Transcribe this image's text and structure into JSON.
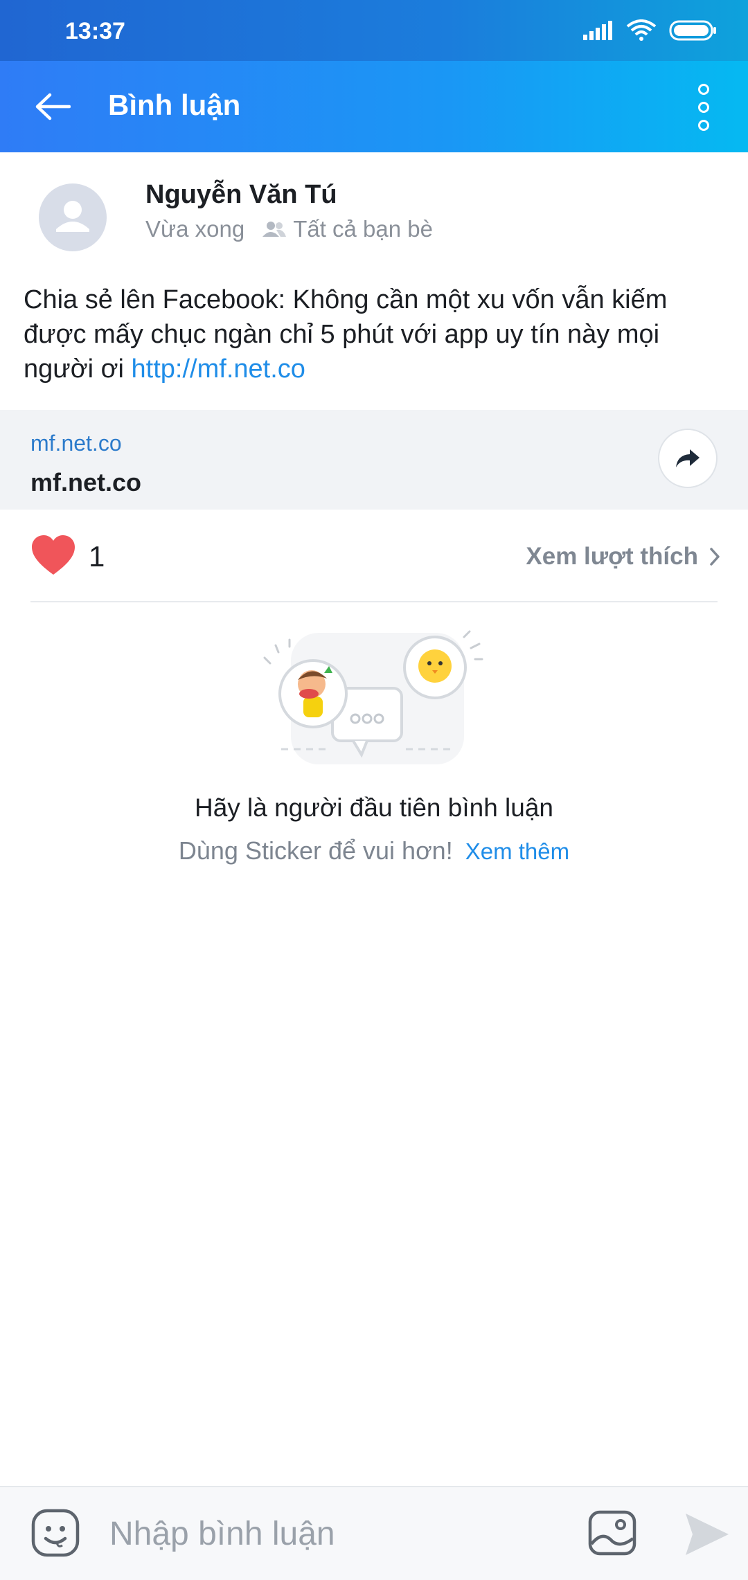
{
  "status_bar": {
    "time": "13:37"
  },
  "app_bar": {
    "title": "Bình luận"
  },
  "post": {
    "author": "Nguyễn Văn Tú",
    "time": "Vừa xong",
    "audience": "Tất cả bạn bè",
    "text": "Chia sẻ lên Facebook: Không cần một xu vốn vẫn kiếm được mấy chục ngàn chỉ 5 phút với app uy tín này mọi người ơi ",
    "inline_link": "http://mf.net.co"
  },
  "link_card": {
    "domain": "mf.net.co",
    "title": "mf.net.co"
  },
  "likes": {
    "count": "1",
    "see_likes_label": "Xem lượt thích"
  },
  "empty_state": {
    "title": "Hãy là người đầu tiên bình luận",
    "subtitle": "Dùng Sticker để vui hơn!",
    "more_link": "Xem thêm"
  },
  "composer": {
    "placeholder": "Nhập bình luận"
  },
  "colors": {
    "accent": "#1f8de8",
    "heart": "#f0555a",
    "header_start": "#2f7cf6",
    "header_end": "#05b9f2"
  },
  "icons": [
    "back-arrow-icon",
    "more-vertical-icon",
    "friends-icon",
    "share-arrow-icon",
    "heart-icon",
    "chevron-right-icon",
    "emoji-icon",
    "image-icon",
    "send-icon"
  ]
}
